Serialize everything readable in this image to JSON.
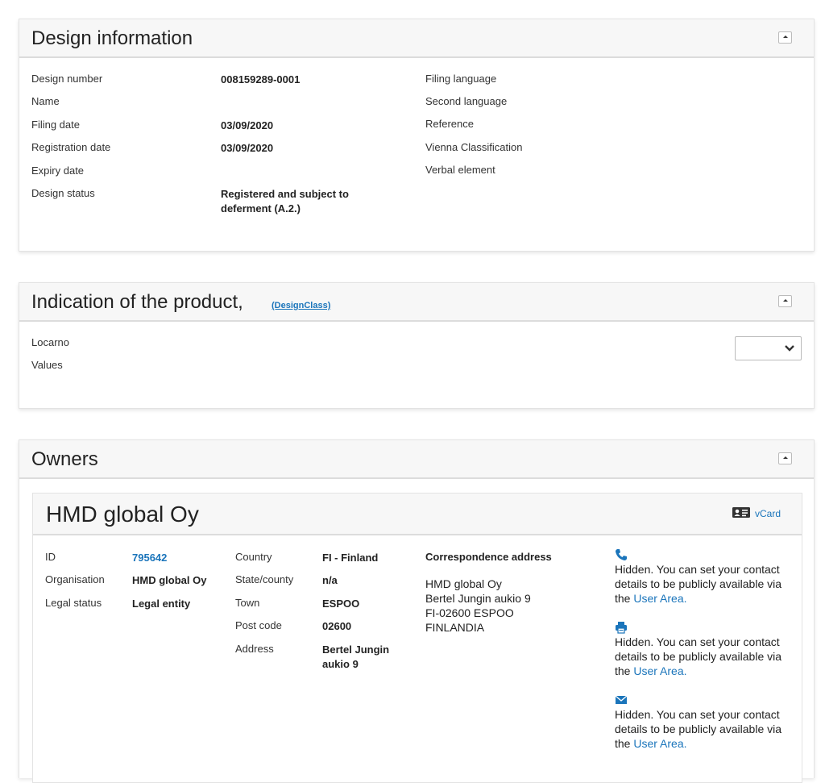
{
  "design_info": {
    "title": "Design information",
    "rows_left": [
      {
        "label": "Design number",
        "value": "008159289-0001"
      },
      {
        "label": "Name",
        "value": ""
      },
      {
        "label": "Filing date",
        "value": "03/09/2020"
      },
      {
        "label": "Registration date",
        "value": "03/09/2020"
      },
      {
        "label": "Expiry date",
        "value": ""
      },
      {
        "label": "Design status",
        "value_line1": "Registered and subject to",
        "value_line2": "deferment (A.2.)"
      }
    ],
    "rows_right": [
      {
        "label": "Filing language"
      },
      {
        "label": "Second language"
      },
      {
        "label": "Reference"
      },
      {
        "label": "Vienna Classification"
      },
      {
        "label": "Verbal element"
      }
    ]
  },
  "product": {
    "title": "Indication of the product,",
    "designclass_link": "(DesignClass)",
    "locarno_label": "Locarno",
    "values_label": "Values",
    "select_value": ""
  },
  "owners": {
    "title": "Owners",
    "owner": {
      "name": "HMD global Oy",
      "vcard_label": "vCard",
      "id_label": "ID",
      "id_value": "795642",
      "organisation_label": "Organisation",
      "organisation_value": "HMD global Oy",
      "legal_status_label": "Legal status",
      "legal_status_value": "Legal entity",
      "country_label": "Country",
      "country_value": "FI - Finland",
      "state_label": "State/county",
      "state_value": "n/a",
      "town_label": "Town",
      "town_value": "ESPOO",
      "postcode_label": "Post code",
      "postcode_value": "02600",
      "address_label": "Address",
      "address_value_line1": "Bertel Jungin",
      "address_value_line2": "aukio 9",
      "correspondence_title": "Correspondence address",
      "correspondence_lines": [
        "HMD global Oy",
        "Bertel Jungin aukio 9",
        "FI-02600 ESPOO",
        "FINLANDIA"
      ],
      "contact_text_line1": "Hidden. You can set your contact",
      "contact_text_line2": "details to be publicly available via",
      "contact_text_prefix": "the ",
      "user_area_link": "User Area.",
      "icons": [
        "phone-icon",
        "fax-icon",
        "email-icon"
      ]
    }
  },
  "colors": {
    "link": "#1b75bb",
    "header_bg": "#f7f7f7",
    "icon": "#1b75bb"
  }
}
